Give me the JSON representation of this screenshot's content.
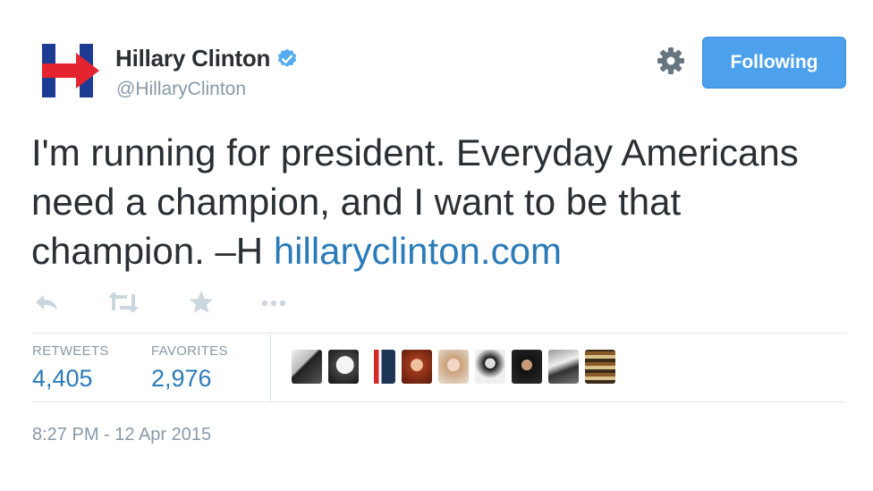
{
  "account": {
    "display_name": "Hillary Clinton",
    "handle": "@HillaryClinton",
    "verified_icon": "verified-badge-icon"
  },
  "header": {
    "follow_label": "Following",
    "gear_icon": "gear-icon"
  },
  "tweet": {
    "text": "I'm running for president. Everyday Americans need a champion, and I want to be that champion. –H ",
    "link": "hillaryclinton.com"
  },
  "actions": [
    "reply-icon",
    "retweet-icon",
    "favorite-icon",
    "more-icon"
  ],
  "stats": {
    "retweets_label": "RETWEETS",
    "retweets_value": "4,405",
    "favorites_label": "FAVORITES",
    "favorites_value": "2,976"
  },
  "timestamp": "8:27 PM - 12 Apr 2015",
  "colors": {
    "link": "#2b7bb9",
    "follow_button": "#4ca0ec",
    "logo_blue": "#1b3c92",
    "logo_red": "#e4242f",
    "muted": "#8899a6"
  }
}
